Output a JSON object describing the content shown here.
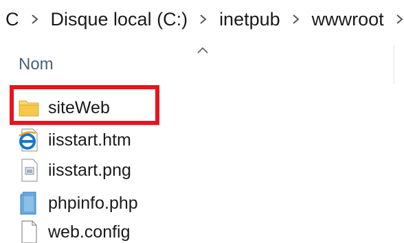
{
  "breadcrumb": {
    "items": [
      "C",
      "Disque local (C:)",
      "inetpub",
      "wwwroot"
    ]
  },
  "list": {
    "column_header": "Nom",
    "files": [
      {
        "name": "siteWeb",
        "icon": "folder-icon"
      },
      {
        "name": "iisstart.htm",
        "icon": "html-file-icon"
      },
      {
        "name": "iisstart.png",
        "icon": "image-file-icon"
      },
      {
        "name": "phpinfo.php",
        "icon": "php-file-icon"
      },
      {
        "name": "web.config",
        "icon": "config-file-icon"
      }
    ]
  },
  "colors": {
    "highlight": "#e8141c",
    "header_text": "#4c607a",
    "folder": "#f5c84c"
  }
}
